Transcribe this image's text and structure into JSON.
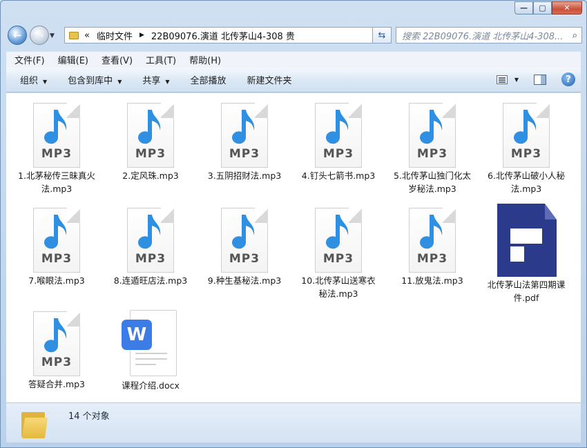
{
  "window": {
    "controls": {
      "minimize": "—",
      "maximize": "▢",
      "close": "✕"
    }
  },
  "nav": {
    "back_symbol": "←",
    "forward_symbol": "→",
    "history_dropdown": "▼"
  },
  "address": {
    "overflow": "«",
    "segments": [
      "临时文件",
      "22B09076.演道 北传茅山4-308 贵"
    ],
    "separator": "▶",
    "dropdown": "▼",
    "refresh_symbol": "⇆"
  },
  "search": {
    "placeholder": "搜索 22B09076.演道 北传茅山4-308...",
    "icon": "search-icon"
  },
  "menubar": {
    "items": [
      "文件(F)",
      "编辑(E)",
      "查看(V)",
      "工具(T)",
      "帮助(H)"
    ]
  },
  "commandbar": {
    "items": [
      {
        "label": "组织",
        "has_arrow": true
      },
      {
        "label": "包含到库中",
        "has_arrow": true
      },
      {
        "label": "共享",
        "has_arrow": true
      },
      {
        "label": "全部播放",
        "has_arrow": false
      },
      {
        "label": "新建文件夹",
        "has_arrow": false
      }
    ],
    "dropdown_arrow": "▼",
    "help_symbol": "?"
  },
  "files": [
    {
      "name": "1.北茅秘传三昧真火法.mp3",
      "type": "mp3"
    },
    {
      "name": "2.定风珠.mp3",
      "type": "mp3"
    },
    {
      "name": "3.五阴招财法.mp3",
      "type": "mp3"
    },
    {
      "name": "4.钉头七箭书.mp3",
      "type": "mp3"
    },
    {
      "name": "5.北传茅山独门化太岁秘法.mp3",
      "type": "mp3"
    },
    {
      "name": "6.北传茅山破小人秘法.mp3",
      "type": "mp3"
    },
    {
      "name": "7.喉眼法.mp3",
      "type": "mp3"
    },
    {
      "name": "8.连遁旺店法.mp3",
      "type": "mp3"
    },
    {
      "name": "9.种生基秘法.mp3",
      "type": "mp3"
    },
    {
      "name": "10.北传茅山送寒衣秘法.mp3",
      "type": "mp3"
    },
    {
      "name": "11.放鬼法.mp3",
      "type": "mp3"
    },
    {
      "name": "北传茅山法第四期课件.pdf",
      "type": "pdf"
    },
    {
      "name": "答疑合并.mp3",
      "type": "mp3"
    },
    {
      "name": "课程介绍.docx",
      "type": "docx"
    }
  ],
  "icon_text": {
    "mp3": "MP3",
    "docx": "W"
  },
  "colors": {
    "note_blue": "#2f8fe0",
    "pdf_navy": "#2c3a8c",
    "word_blue": "#3b7ce6"
  },
  "status": {
    "count_text": "14 个对象"
  }
}
